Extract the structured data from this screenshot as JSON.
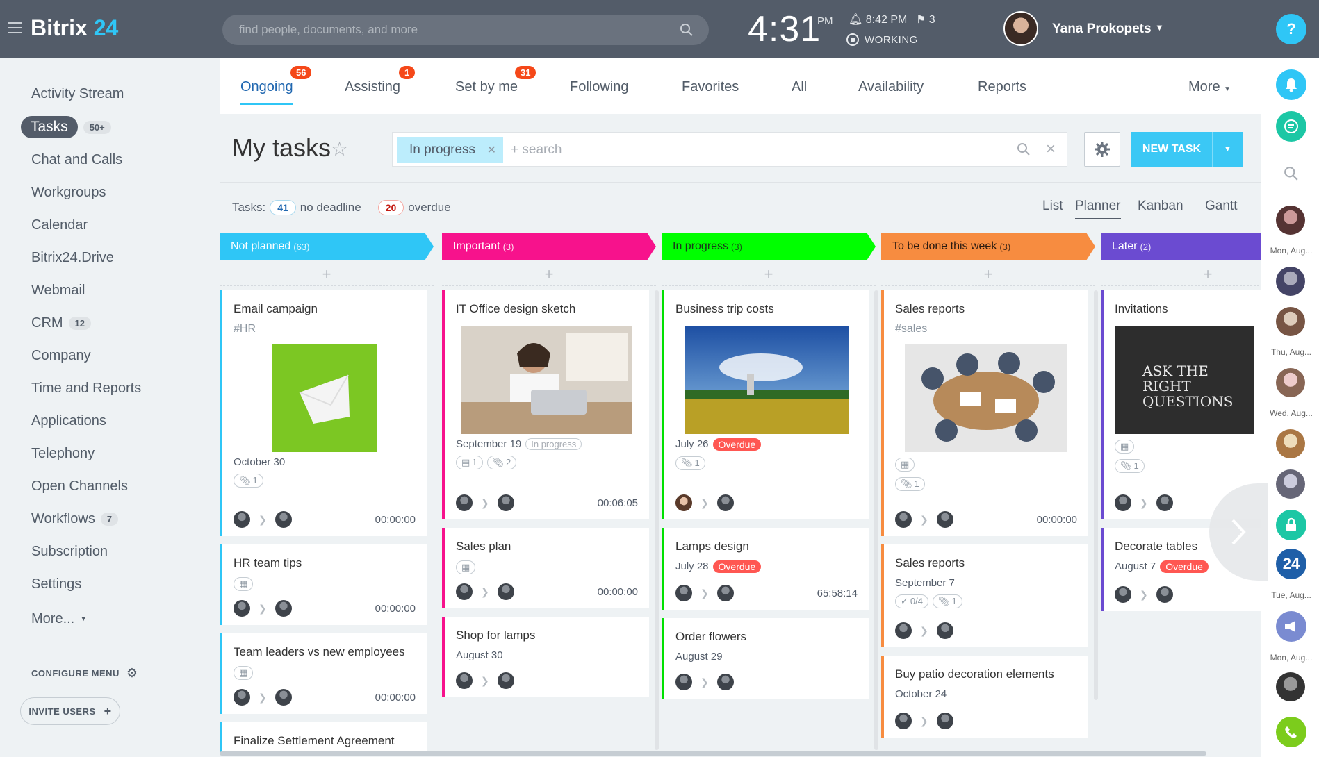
{
  "header": {
    "logo_main": "Bitrix",
    "logo_num": "24",
    "search_placeholder": "find people, documents, and more",
    "clock": "4:31",
    "ampm": "PM",
    "alarm": "8:42 PM",
    "flags": "3",
    "status": "WORKING",
    "user": "Yana Prokopets"
  },
  "rail": {
    "labels": [
      "Mon, Aug...",
      "Thu, Aug...",
      "Wed, Aug...",
      "Tue, Aug...",
      "Mon, Aug..."
    ],
    "help": "?",
    "b24": "24"
  },
  "menu": {
    "items": [
      {
        "label": "Activity Stream"
      },
      {
        "label": "Tasks",
        "count": "50+"
      },
      {
        "label": "Chat and Calls"
      },
      {
        "label": "Workgroups"
      },
      {
        "label": "Calendar"
      },
      {
        "label": "Bitrix24.Drive"
      },
      {
        "label": "Webmail"
      },
      {
        "label": "CRM",
        "count": "12"
      },
      {
        "label": "Company"
      },
      {
        "label": "Time and Reports"
      },
      {
        "label": "Applications"
      },
      {
        "label": "Telephony"
      },
      {
        "label": "Open Channels"
      },
      {
        "label": "Workflows",
        "count": "7"
      },
      {
        "label": "Subscription"
      },
      {
        "label": "Settings"
      },
      {
        "label": "More..."
      }
    ],
    "configure": "CONFIGURE MENU",
    "invite": "INVITE USERS"
  },
  "tabs": [
    {
      "label": "Ongoing",
      "badge": "56"
    },
    {
      "label": "Assisting",
      "badge": "1"
    },
    {
      "label": "Set by me",
      "badge": "31"
    },
    {
      "label": "Following"
    },
    {
      "label": "Favorites"
    },
    {
      "label": "All"
    },
    {
      "label": "Availability"
    },
    {
      "label": "Reports"
    },
    {
      "label": "More"
    }
  ],
  "page": {
    "title": "My tasks",
    "filter_chip": "In progress",
    "filter_search": "+ search",
    "new_task": "NEW TASK",
    "tasks_label": "Tasks:",
    "no_deadline_count": "41",
    "no_deadline": "no deadline",
    "overdue_count": "20",
    "overdue": "overdue",
    "views": [
      "List",
      "Planner",
      "Kanban",
      "Gantt"
    ]
  },
  "columns": [
    {
      "title": "Not planned",
      "count": "(63)",
      "color": "#2fc6f6"
    },
    {
      "title": "Important",
      "count": "(3)",
      "color": "#f7128c"
    },
    {
      "title": "In progress",
      "count": "(3)",
      "color": "#00ff00"
    },
    {
      "title": "To be done this week",
      "count": "(3)",
      "color": "#f78c40"
    },
    {
      "title": "Later",
      "count": "(2)",
      "color": "#6b4bd1"
    }
  ],
  "cards": {
    "c0": [
      {
        "title": "Email campaign",
        "tag": "#HR",
        "date": "October 30",
        "attach": "1",
        "time": "00:00:00"
      },
      {
        "title": "HR team tips",
        "time": "00:00:00"
      },
      {
        "title": "Team leaders vs new employees",
        "time": "00:00:00"
      },
      {
        "title": "Finalize Settlement Agreement (Shanon Firm)"
      }
    ],
    "c1": [
      {
        "title": "IT Office design sketch",
        "date": "September 19",
        "status": "In progress",
        "sub": "1",
        "attach": "2",
        "time": "00:06:05"
      },
      {
        "title": "Sales plan",
        "time": "00:00:00"
      },
      {
        "title": "Shop for lamps",
        "date": "August 30"
      }
    ],
    "c2": [
      {
        "title": "Business trip costs",
        "date": "July 26",
        "overdue": "Overdue",
        "attach": "1"
      },
      {
        "title": "Lamps design",
        "date": "July 28",
        "overdue": "Overdue",
        "time": "65:58:14"
      },
      {
        "title": "Order flowers",
        "date": "August 29"
      }
    ],
    "c3": [
      {
        "title": "Sales reports",
        "tag": "#sales",
        "attach": "1",
        "time": "00:00:00"
      },
      {
        "title": "Sales reports",
        "date": "September 7",
        "checklist": "0/4",
        "attach": "1"
      },
      {
        "title": "Buy patio decoration elements",
        "date": "October 24"
      }
    ],
    "c4": [
      {
        "title": "Invitations",
        "img_text": "ASK THE RIGHT QUESTIONS",
        "attach": "1"
      },
      {
        "title": "Decorate tables",
        "date": "August 7",
        "overdue": "Overdue"
      }
    ]
  }
}
